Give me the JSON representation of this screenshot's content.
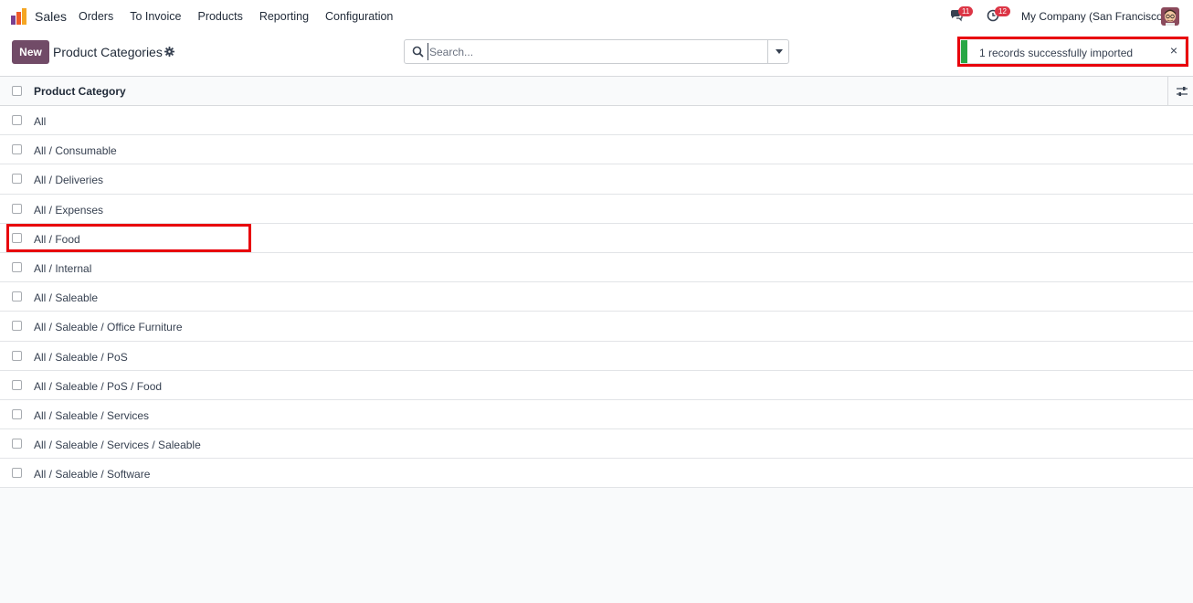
{
  "navbar": {
    "app_name": "Sales",
    "menu": [
      "Orders",
      "To Invoice",
      "Products",
      "Reporting",
      "Configuration"
    ],
    "messages_badge": "11",
    "activities_badge": "12",
    "company": "My Company (San Francisco)"
  },
  "control_panel": {
    "new_label": "New",
    "title": "Product Categories",
    "search_placeholder": "Search..."
  },
  "notification": {
    "message": "1 records successfully imported",
    "close": "×",
    "status_color": "#28a745"
  },
  "list": {
    "column_header": "Product Category",
    "rows": [
      "All",
      "All / Consumable",
      "All / Deliveries",
      "All / Expenses",
      "All / Food",
      "All / Internal",
      "All / Saleable",
      "All / Saleable / Office Furniture",
      "All / Saleable / PoS",
      "All / Saleable / PoS / Food",
      "All / Saleable / Services",
      "All / Saleable / Services / Saleable",
      "All / Saleable / Software"
    ]
  },
  "colors": {
    "brand": "#714b67",
    "highlight": "#e8000b",
    "badge": "#dc3545"
  }
}
